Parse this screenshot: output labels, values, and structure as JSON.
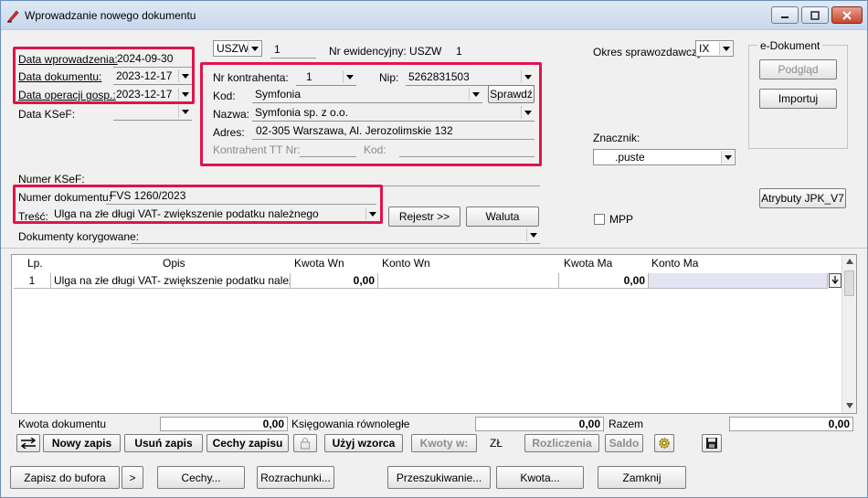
{
  "window": {
    "title": "Wprowadzanie nowego dokumentu"
  },
  "colors": {
    "highlight": "#e0144c",
    "titlebar": "#c7d7ec"
  },
  "header": {
    "data_wprowadzenia_label": "Data wprowadzenia:",
    "data_wprowadzenia": "2024-09-30",
    "data_dokumentu_label": "Data dokumentu:",
    "data_dokumentu": "2023-12-17",
    "data_operacji_label": "Data operacji gosp.:",
    "data_operacji": "2023-12-17",
    "data_ksef_label": "Data KSeF:",
    "data_ksef": "",
    "rejestr": "USZW",
    "rejestr_nr": "1",
    "nr_ewidencyjny_label": "Nr ewidencyjny: USZW",
    "nr_ewidencyjny": "1",
    "okres_label": "Okres sprawozdawczy:",
    "okres": "IX"
  },
  "kontrahent": {
    "nr_label": "Nr kontrahenta:",
    "nr": "1",
    "nip_label": "Nip:",
    "nip": "5262831503",
    "kod_label": "Kod:",
    "kod": "Symfonia",
    "sprawdz": "Sprawdź",
    "nazwa_label": "Nazwa:",
    "nazwa": "Symfonia sp. z o.o.",
    "adres_label": "Adres:",
    "adres": "02-305 Warszawa, Al. Jerozolimskie 132",
    "tt_nr_label": "Kontrahent TT Nr:",
    "tt_kod_label": "Kod:"
  },
  "edokument": {
    "title": "e-Dokument",
    "podglad": "Podgląd",
    "importuj": "Importuj"
  },
  "znacznik": {
    "label": "Znacznik:",
    "value": ".puste"
  },
  "atrybuty": "Atrybuty JPK_V7",
  "mpp_label": "MPP",
  "dokument": {
    "numer_ksef_label": "Numer KSeF:",
    "numer_label": "Numer dokumentu:",
    "numer": "FVS 1260/2023",
    "tresc_label": "Treść:",
    "tresc": "Ulga na złe długi VAT- zwiększenie podatku należnego",
    "rejestr_btn": "Rejestr >>",
    "waluta_btn": "Waluta",
    "korygowane_label": "Dokumenty korygowane:"
  },
  "grid": {
    "columns": [
      "Lp.",
      "Opis",
      "Kwota Wn",
      "Konto Wn",
      "Kwota Ma",
      "Konto Ma"
    ],
    "rows": [
      {
        "lp": "1",
        "opis": "Ulga na złe długi VAT- zwiększenie podatku należnego",
        "kwota_wn": "0,00",
        "konto_wn": "",
        "kwota_ma": "0,00",
        "konto_ma": ""
      }
    ]
  },
  "summary": {
    "kwota_label": "Kwota dokumentu",
    "kwota": "0,00",
    "ksiegowania_label": "Księgowania równoległe",
    "ksiegowania": "0,00",
    "razem_label": "Razem",
    "razem": "0,00"
  },
  "toolbar": {
    "nowy": "Nowy zapis",
    "usun": "Usuń zapis",
    "cechy_zapisu": "Cechy zapisu",
    "uzyj_wzorca": "Użyj wzorca",
    "kwoty_w": "Kwoty w:",
    "currency": "ZŁ",
    "rozliczenia": "Rozliczenia",
    "saldo": "Saldo"
  },
  "bottom": {
    "zapisz": "Zapisz do bufora",
    "more": ">",
    "cechy": "Cechy...",
    "rozrachunki": "Rozrachunki...",
    "przeszukiwanie": "Przeszukiwanie...",
    "kwota": "Kwota...",
    "zamknij": "Zamknij"
  }
}
